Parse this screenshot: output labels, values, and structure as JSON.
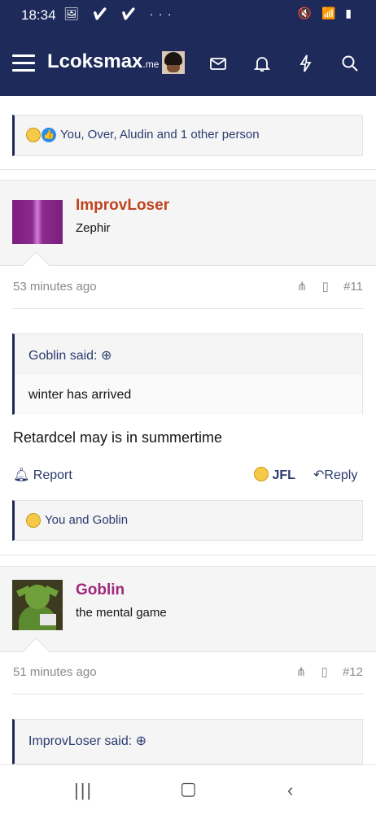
{
  "status_bar": {
    "time": "18:34",
    "left_icons": "🖼 ✔ ✔ ···",
    "right_icons": "🔇 📶 ▮"
  },
  "nav": {
    "logo_main": "Lcoksmax",
    "logo_tld": ".me",
    "icons": [
      "menu-icon",
      "avatar",
      "mail-icon",
      "bell-icon",
      "lightning-icon",
      "search-icon"
    ]
  },
  "reactions_top": {
    "text": "You, Over, Aludin and 1 other person"
  },
  "post11": {
    "username": "ImprovLoser",
    "username_color": "#c0431e",
    "user_title": "Zephir",
    "time": "53 minutes ago",
    "number": "#11",
    "quote_author": "Goblin said:",
    "quote_text": "winter has arrived",
    "body": "Retardcel may is in summertime",
    "report_label": "Report",
    "jfl_label": "JFL",
    "reply_label": "Reply",
    "reactions": "You and Goblin"
  },
  "post12": {
    "username": "Goblin",
    "username_color": "#a0287a",
    "user_title": "the mental game",
    "time": "51 minutes ago",
    "number": "#12",
    "quote_author": "ImprovLoser said:"
  }
}
